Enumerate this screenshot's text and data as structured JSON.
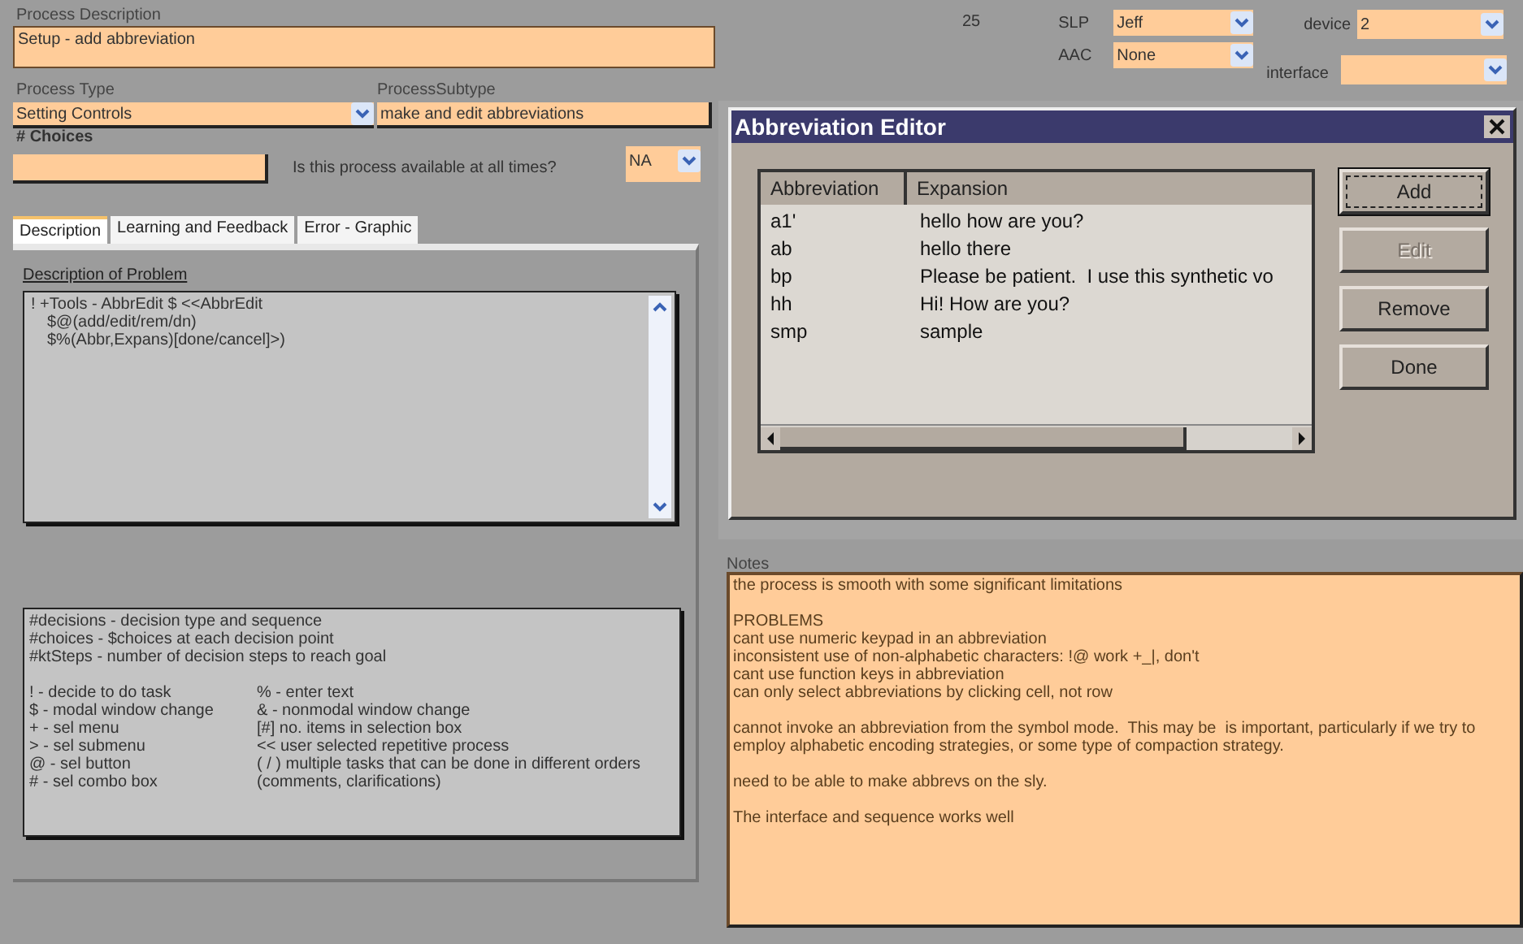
{
  "process_description": {
    "label": "Process Description",
    "value": "Setup - add abbreviation"
  },
  "process_type": {
    "label": "Process Type",
    "value": "Setting Controls"
  },
  "process_subtype": {
    "label": "ProcessSubtype",
    "value": "make and edit abbreviations"
  },
  "choices": {
    "label": "# Choices"
  },
  "availability": {
    "question": "Is this process available at all times?",
    "value": "NA"
  },
  "tabs": [
    {
      "label": "Description",
      "selected": true
    },
    {
      "label": "Learning and Feedback",
      "selected": false
    },
    {
      "label": "Error - Graphic",
      "selected": false
    }
  ],
  "description_of_problem": {
    "label": "Description of Problem",
    "lines": [
      "! +Tools - AbbrEdit $ <<AbbrEdit",
      "$@(add/edit/rem/dn)",
      "$%(Abbr,Expans)[done/cancel]>)"
    ]
  },
  "legend": {
    "header_lines": [
      "#decisions - decision type and sequence",
      "#choices - $choices at each decision point",
      "#ktSteps - number of decision steps to reach goal"
    ],
    "pairs": [
      [
        "! - decide to do task",
        "% - enter text"
      ],
      [
        "$ - modal window change",
        "& - nonmodal window change"
      ],
      [
        "+ - sel menu",
        "[#] no. items in selection box"
      ],
      [
        "> - sel submenu",
        "<< user selected repetitive process"
      ],
      [
        "@ - sel button",
        "( / ) multiple tasks that can be done in different orders"
      ],
      [
        "# - sel combo box",
        "(comments, clarifications)"
      ]
    ]
  },
  "record_number": "25",
  "slp": {
    "label": "SLP",
    "value": "Jeff"
  },
  "aac": {
    "label": "AAC",
    "value": "None"
  },
  "device": {
    "label": "device",
    "value": "2"
  },
  "interface": {
    "label": "interface"
  },
  "dialog": {
    "title": "Abbreviation Editor",
    "columns": [
      "Abbreviation",
      "Expansion"
    ],
    "rows": [
      [
        "a1'",
        "hello how are you?"
      ],
      [
        "ab",
        "hello there"
      ],
      [
        "bp",
        "Please be patient.  I use this synthetic vo"
      ],
      [
        "hh",
        "Hi! How are you?"
      ],
      [
        "smp",
        "sample"
      ]
    ],
    "buttons": [
      {
        "label": "Add",
        "disabled": false,
        "default": true
      },
      {
        "label": "Edit",
        "disabled": true,
        "default": false
      },
      {
        "label": "Remove",
        "disabled": false,
        "default": false
      },
      {
        "label": "Done",
        "disabled": false,
        "default": false
      }
    ]
  },
  "notes": {
    "label": "Notes",
    "paragraphs": [
      [
        "the process is smooth with some significant limitations"
      ],
      [
        "PROBLEMS",
        "cant use numeric keypad in an abbreviation",
        "inconsistent use of non-alphabetic characters: !@ work +_|, don't",
        "cant use function keys in abbreviation",
        "can only select abbreviations by clicking cell, not row"
      ],
      [
        "cannot invoke an abbreviation from the symbol mode.  This may be  is important, particularly if we try to employ alphabetic encoding strategies, or some type of compaction strategy."
      ],
      [
        "need to be able to make abbrevs on the sly."
      ],
      [
        "The interface and sequence works well"
      ]
    ]
  }
}
